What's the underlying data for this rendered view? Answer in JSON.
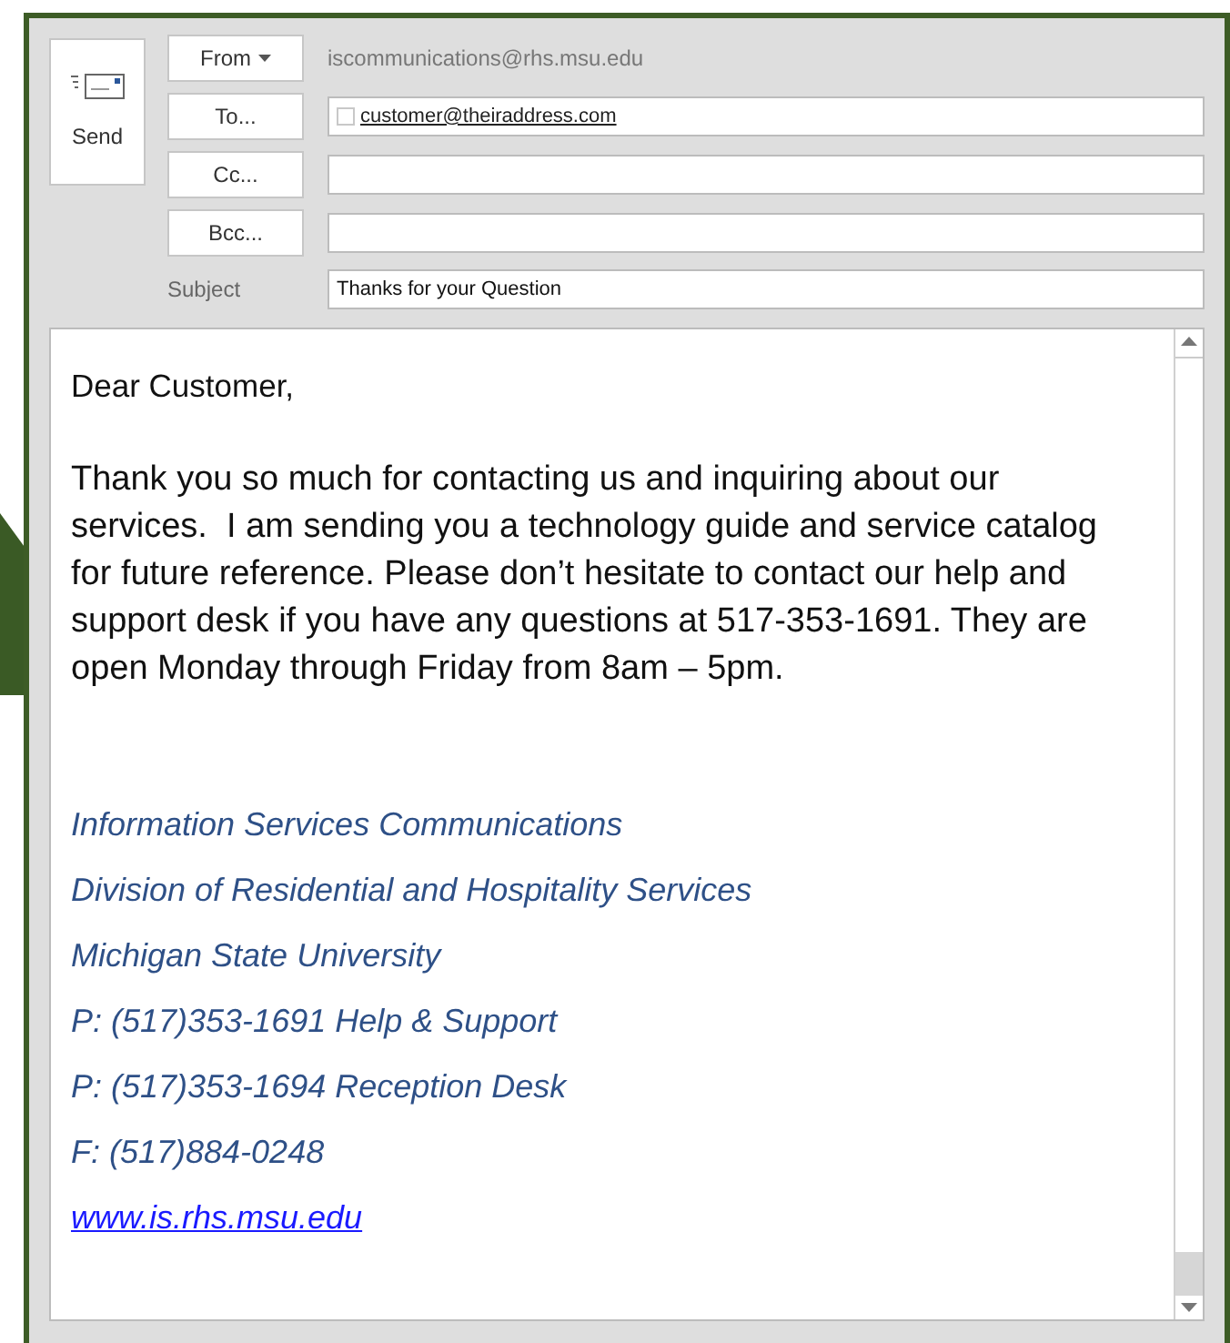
{
  "send_button": {
    "label": "Send"
  },
  "header_fields": [
    {
      "kind": "from",
      "button": "From",
      "value": "iscommunications@rhs.msu.edu"
    },
    {
      "kind": "recipients",
      "button": "To...",
      "recipients": [
        {
          "address": "customer@theiraddress.com",
          "checked": false
        }
      ]
    },
    {
      "kind": "recipients",
      "button": "Cc..."
    },
    {
      "kind": "recipients",
      "button": "Bcc..."
    },
    {
      "kind": "subject",
      "label": "Subject",
      "value": "Thanks for your Question"
    }
  ],
  "body": {
    "greeting": "Dear Customer,",
    "paragraph": "Thank you so much for contacting us and inquiring about our services.  I am sending you a technology guide and service catalog for future reference. Please don’t hesitate to contact our help and support desk if you have any questions at 517-353-1691. They are open Monday through Friday from 8am – 5pm.",
    "signature": [
      {
        "kind": "text",
        "text": "Information Services Communications"
      },
      {
        "kind": "text",
        "text": "Division of Residential and Hospitality Services"
      },
      {
        "kind": "text",
        "text": "Michigan State University"
      },
      {
        "kind": "text",
        "text": "P: (517)353-1691 Help & Support"
      },
      {
        "kind": "text",
        "text": "P: (517)353-1694 Reception Desk"
      },
      {
        "kind": "text",
        "text": "F: (517)884-0248"
      },
      {
        "kind": "link",
        "text": "www.is.rhs.msu.edu"
      }
    ]
  }
}
